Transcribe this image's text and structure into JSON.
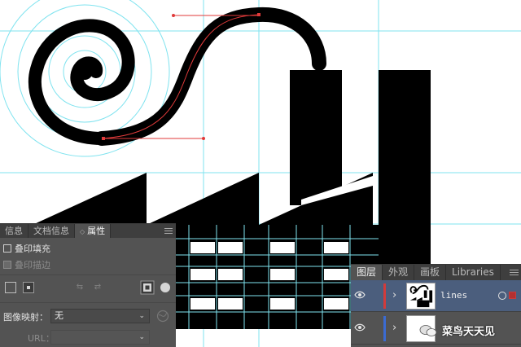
{
  "properties_panel": {
    "tabs": [
      "信息",
      "文档信息",
      "属性"
    ],
    "active_tab": "属性",
    "overprint_fill": "叠印填充",
    "overprint_stroke": "叠印描边",
    "image_map_label": "图像映射：",
    "image_map_value": "无",
    "url_label": "URL："
  },
  "layers_panel": {
    "tabs": [
      "图层",
      "外观",
      "画板",
      "Libraries"
    ],
    "active_tab": "图层",
    "layers": [
      {
        "name": "lines",
        "color": "#d23b3b",
        "selected": true
      },
      {
        "name": "",
        "color": "#3b6bd2",
        "selected": false
      }
    ]
  },
  "watermark": {
    "text": "菜鸟天天见"
  },
  "colors": {
    "guide": "#7fe3ef",
    "path_highlight": "#e03a3a",
    "panel_bg": "#535353",
    "selection_bg": "#4b5e7d"
  }
}
